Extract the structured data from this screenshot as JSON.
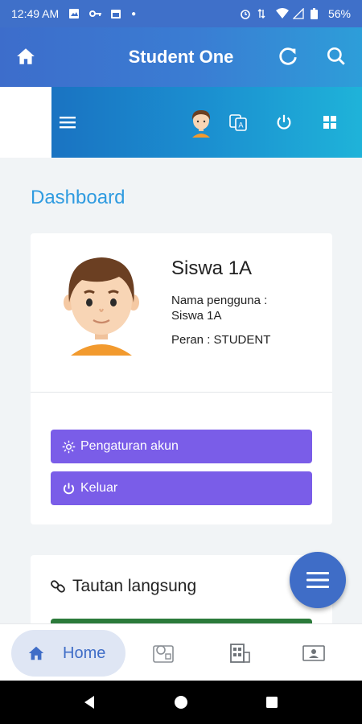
{
  "status_bar": {
    "time": "12:49 AM",
    "battery": "56%"
  },
  "app_bar": {
    "title": "Student One"
  },
  "content": {
    "section_title": "Dashboard",
    "profile": {
      "name": "Siswa 1A",
      "username_label": "Nama pengguna :",
      "username": "Siswa 1A",
      "role": "Peran : STUDENT"
    },
    "buttons": {
      "account_settings": "Pengaturan akun",
      "logout": "Keluar"
    },
    "links": {
      "title": "Tautan langsung"
    }
  },
  "bottom_nav": {
    "items": [
      {
        "label": "Home",
        "icon": "home-icon",
        "active": true
      },
      {
        "label": "",
        "icon": "id-card-icon"
      },
      {
        "label": "",
        "icon": "building-icon"
      },
      {
        "label": "",
        "icon": "contact-card-icon"
      }
    ]
  },
  "colors": {
    "primary": "#3f6dc7",
    "toolbar": "#1b8fd0",
    "accent_button": "#7a5de8",
    "dashboard_title": "#2f9be0",
    "green_bar": "#2b7a3a"
  }
}
